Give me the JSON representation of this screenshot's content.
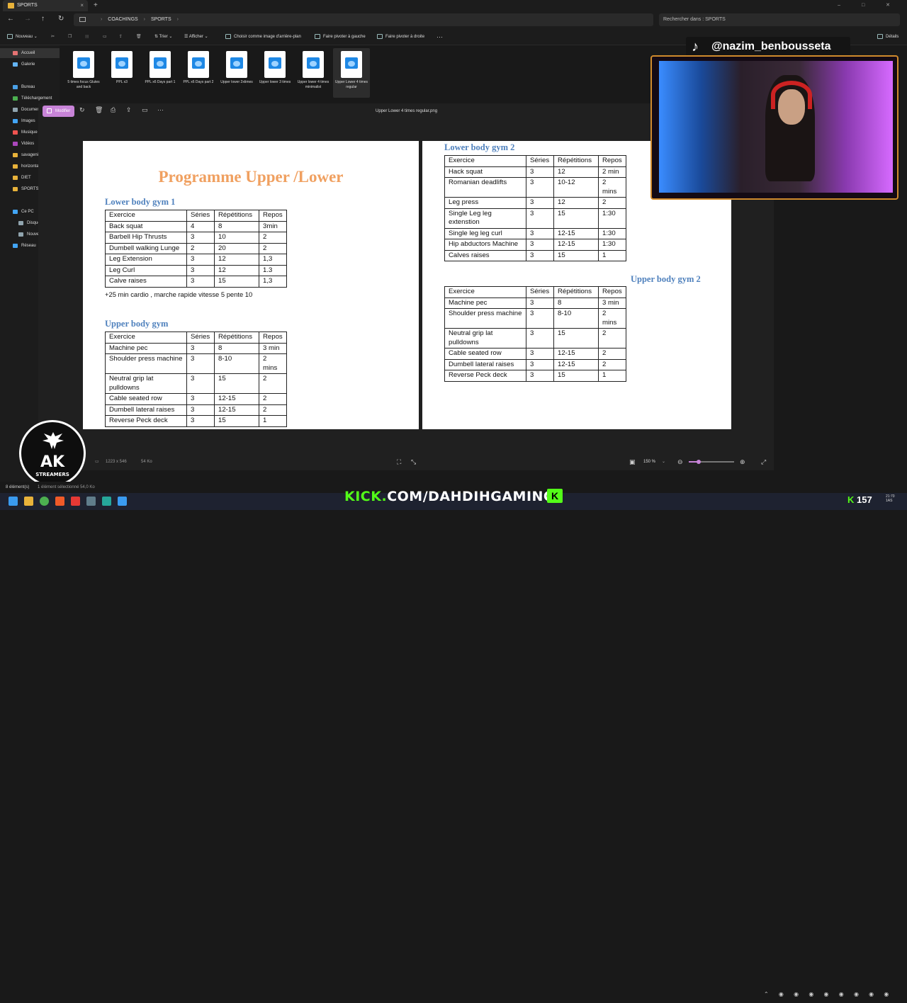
{
  "titlebar": {
    "tab_label": "SPORTS",
    "tab_close": "×",
    "new_tab": "+",
    "window_controls": "–  □  ✕"
  },
  "address": {
    "crumbs": [
      "COACHINGS",
      "SPORTS"
    ],
    "search_placeholder": "Rechercher dans : SPORTS"
  },
  "commands": {
    "new": "Nouveau",
    "sort": "Trier",
    "view": "Afficher",
    "set_background": "Choisir comme image d'arrière-plan",
    "rotate_left": "Faire pivoter à gauche",
    "rotate_right": "Faire pivoter à droite",
    "more": "···",
    "details": "Détails"
  },
  "sidebar": {
    "items": [
      {
        "label": "Accueil",
        "color": "#e57373"
      },
      {
        "label": "Galerie",
        "color": "#64b5f6"
      },
      {
        "label": "Bureau",
        "color": "#4aa0e6"
      },
      {
        "label": "Téléchargement",
        "color": "#4caf50"
      },
      {
        "label": "Documents",
        "color": "#90a4ae"
      },
      {
        "label": "Images",
        "color": "#42a5f5"
      },
      {
        "label": "Musique",
        "color": "#ef5350"
      },
      {
        "label": "Vidéos",
        "color": "#ab47bc"
      },
      {
        "label": "savagenin",
        "color": "#e8b23a"
      },
      {
        "label": "horizontal",
        "color": "#e8b23a"
      },
      {
        "label": "DIET",
        "color": "#e8b23a"
      },
      {
        "label": "SPORTS",
        "color": "#e8b23a"
      },
      {
        "label": "Ce PC",
        "color": "#42a5f5"
      },
      {
        "label": "Disque lo",
        "color": "#90a4ae"
      },
      {
        "label": "Nouveau",
        "color": "#90a4ae"
      },
      {
        "label": "Réseau",
        "color": "#42a5f5"
      }
    ]
  },
  "files": [
    {
      "label": "5 times focus Glutes and back"
    },
    {
      "label": "PPL x3"
    },
    {
      "label": "PPL x6 Days part 1"
    },
    {
      "label": "PPL x6 Days part 2"
    },
    {
      "label": "Upper lower 2xtimes"
    },
    {
      "label": "Upper lower 3 times"
    },
    {
      "label": "Upper lower 4 times minimalist"
    },
    {
      "label": "Upper Lower 4 times regular"
    }
  ],
  "viewer": {
    "edit_label": "Modifier",
    "filename": "Upper Lower 4 times regular.png",
    "dimensions": "1223 x 546",
    "size": "54 Ko",
    "zoom": "150 %"
  },
  "document": {
    "title": "Programme Upper /Lower",
    "lower1": {
      "heading": "Lower body gym 1",
      "header": [
        "Exercice",
        "Séries",
        "Répétitions",
        "Repos"
      ],
      "rows": [
        [
          "Back squat",
          "4",
          "8",
          "3min"
        ],
        [
          "Barbell Hip Thrusts",
          "3",
          "10",
          "2"
        ],
        [
          "Dumbell walking Lunge",
          "2",
          "20",
          "2"
        ],
        [
          "Leg Extension",
          "3",
          "12",
          "1,3"
        ],
        [
          "Leg Curl",
          "3",
          "12",
          "1.3"
        ],
        [
          "Calve raises",
          "3",
          "15",
          "1,3"
        ]
      ],
      "note": "+25 min cardio , marche rapide vitesse 5 pente 10"
    },
    "upper1": {
      "heading": "Upper body gym",
      "header": [
        "Exercice",
        "Séries",
        "Répétitions",
        "Repos"
      ],
      "rows": [
        [
          "Machine pec",
          "3",
          "8",
          "3 min"
        ],
        [
          "Shoulder press machine",
          "3",
          "8-10",
          "2 mins"
        ],
        [
          "Neutral grip lat pulldowns",
          "3",
          "15",
          "2"
        ],
        [
          "Cable seated row",
          "3",
          "12-15",
          "2"
        ],
        [
          "Dumbell lateral raises",
          "3",
          "12-15",
          "2"
        ],
        [
          "Reverse Peck deck",
          "3",
          "15",
          "1"
        ]
      ]
    },
    "lower2": {
      "heading": "Lower body gym 2",
      "header": [
        "Exercice",
        "Séries",
        "Répétitions",
        "Repos"
      ],
      "rows": [
        [
          "Hack squat",
          "3",
          "12",
          "2 min"
        ],
        [
          "Romanian deadlifts",
          "3",
          "10-12",
          "2 mins"
        ],
        [
          "Leg press",
          "3",
          "12",
          "2"
        ],
        [
          "Single Leg leg extenstion",
          "3",
          "15",
          "1:30"
        ],
        [
          "Single leg leg curl",
          "3",
          "12-15",
          "1:30"
        ],
        [
          "Hip abductors Machine",
          "3",
          "12-15",
          "1:30"
        ],
        [
          "Calves raises",
          "3",
          "15",
          "1"
        ]
      ]
    },
    "upper2": {
      "heading": "Upper body gym 2",
      "header": [
        "Exercice",
        "Séries",
        "Répétitions",
        "Repos"
      ],
      "rows": [
        [
          "Machine pec",
          "3",
          "8",
          "3 min"
        ],
        [
          "Shoulder press machine",
          "3",
          "8-10",
          "2 mins"
        ],
        [
          "Neutral grip lat pulldowns",
          "3",
          "15",
          "2"
        ],
        [
          "Cable seated row",
          "3",
          "12-15",
          "2"
        ],
        [
          "Dumbell lateral raises",
          "3",
          "12-15",
          "2"
        ],
        [
          "Reverse Peck deck",
          "3",
          "15",
          "1"
        ]
      ]
    }
  },
  "overlay": {
    "tiktok_handle": "@nazim_benbousseta",
    "kick_url_prefix": "KICK.",
    "kick_url_rest": "COM/DAHDIHGAMING",
    "kick_logo": "K",
    "ak_logo": "AK",
    "ak_sub": "STREAMERS",
    "counter_icon": "K",
    "counter": "157"
  },
  "status": {
    "items": "8 élément(s)",
    "selection": "1 élément sélectionné 54,0 Ko"
  },
  "clock": {
    "time": "21:70",
    "label": "1AS"
  },
  "colors": {
    "accent_orange": "#f0a060",
    "heading_blue": "#4f81bd",
    "kick_green": "#53fc18",
    "edit_pink": "#c884d8"
  }
}
